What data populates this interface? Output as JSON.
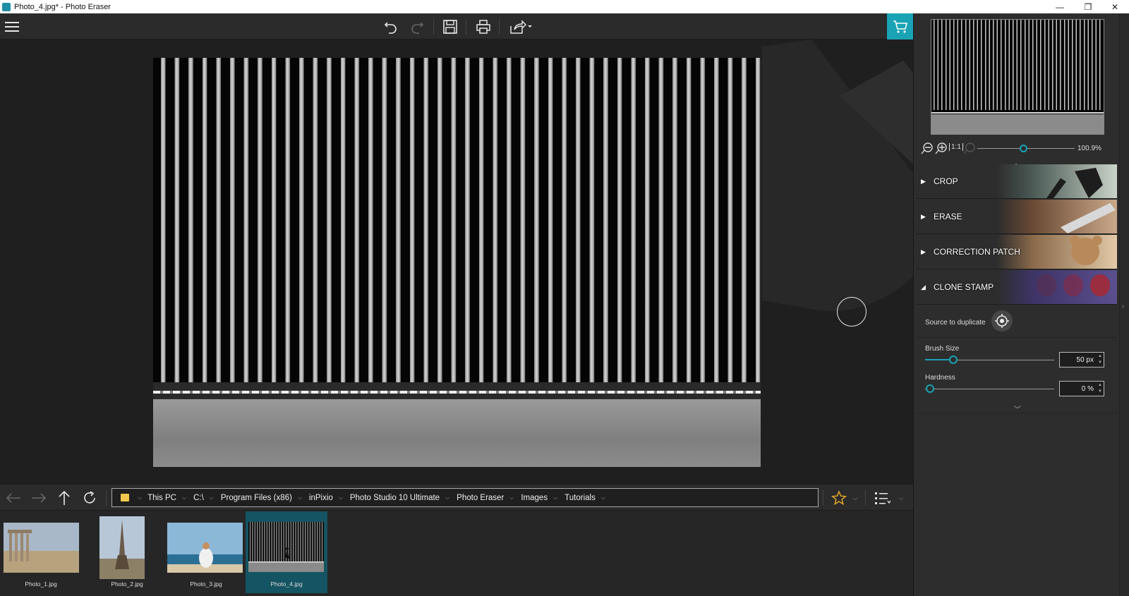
{
  "window": {
    "title": "Photo_4.jpg* - Photo Eraser",
    "minimize": "—",
    "maximize": "❐",
    "close": "✕"
  },
  "toolbar": {
    "menu_icon": "hamburger-icon",
    "undo_icon": "undo-icon",
    "redo_icon": "redo-icon",
    "save_icon": "save-icon",
    "print_icon": "print-icon",
    "share_icon": "share-icon",
    "cart_icon": "cart-icon"
  },
  "preview": {
    "zoom_value": "100.9%",
    "zoom_level": 0.5,
    "zoom_actual_label": "1:1"
  },
  "tools": [
    {
      "label": "CROP",
      "expanded": false
    },
    {
      "label": "ERASE",
      "expanded": false
    },
    {
      "label": "CORRECTION PATCH",
      "expanded": false
    },
    {
      "label": "CLONE STAMP",
      "expanded": true
    }
  ],
  "clone_stamp": {
    "source_label": "Source to duplicate",
    "brush_size_label": "Brush Size",
    "brush_size_value": "50 px",
    "brush_size_fraction": 0.21,
    "hardness_label": "Hardness",
    "hardness_value": "0 %",
    "hardness_fraction": 0.0
  },
  "navigation": {
    "breadcrumbs": [
      "This PC",
      "C:\\",
      "Program Files (x86)",
      "inPixio",
      "Photo Studio 10 Ultimate",
      "Photo Eraser",
      "Images",
      "Tutorials"
    ]
  },
  "filmstrip": [
    {
      "name": "Photo_1.jpg",
      "selected": false
    },
    {
      "name": "Photo_2.jpg",
      "selected": false
    },
    {
      "name": "Photo_3.jpg",
      "selected": false
    },
    {
      "name": "Photo_4.jpg",
      "selected": true
    }
  ],
  "colors": {
    "accent": "#19a3b4",
    "selected_thumb": "#155462",
    "star": "#e2a62a"
  }
}
